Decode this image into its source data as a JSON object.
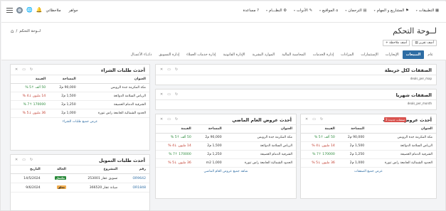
{
  "topbar": {
    "user_label": "جواهر",
    "notes_label": "ملاحظاتي",
    "nav": [
      {
        "label": "التطبيقات",
        "icon": "grid-icon"
      },
      {
        "label": "المشاريع و المهام",
        "icon": "flag-icon"
      },
      {
        "label": "الترحمان",
        "icon": "book-icon"
      },
      {
        "label": "المواقيع",
        "icon": "home-icon"
      },
      {
        "label": "الأدوات",
        "icon": "wrench-icon"
      },
      {
        "label": "النظـــام",
        "icon": "gear-icon"
      },
      {
        "label": "مساعدة",
        "icon": "help-icon"
      }
    ]
  },
  "header": {
    "page_title": "لــوحة التحكم",
    "breadcrumb": "لــوحة التحكم",
    "btn_report": "أضف تقرير",
    "btn_note": "أضف ملاحظة"
  },
  "tabs": [
    {
      "label": "عام",
      "active": false
    },
    {
      "label": "المبيعات",
      "active": true
    },
    {
      "label": "الإيجارات",
      "active": false
    },
    {
      "label": "الإستثمارات",
      "active": false
    },
    {
      "label": "المزادات",
      "active": false
    },
    {
      "label": "إدارة الخدمات",
      "active": false
    },
    {
      "label": "المحاسبة المالية",
      "active": false
    },
    {
      "label": "الموارد البشرية",
      "active": false
    },
    {
      "label": "الإدارة القانونية",
      "active": false
    },
    {
      "label": "إدارة خدمات العملاء",
      "active": false
    },
    {
      "label": "إدارة التسويق",
      "active": false
    },
    {
      "label": "ذكــاء الأعمـال",
      "active": false
    }
  ],
  "panels": {
    "deals_map": {
      "title": "الصفقات لكل خريطة",
      "sub": "deals_per_map"
    },
    "deals_month": {
      "title": "الصفقات شهريا",
      "sub": "deals_per_month"
    },
    "sales_offers": {
      "title": "أحدث عروض المبيعات",
      "badge": "3 صفقات جديدة",
      "cols": [
        "العنوان",
        "المساحة",
        "القيمة"
      ],
      "rows": [
        {
          "addr": "مكة المكرمة جدة الروبس",
          "area": "90,000 م2",
          "val": "50 ألف",
          "pct": "5 %",
          "dir": "up"
        },
        {
          "addr": "الرياض السلامة الدوائعة",
          "area": "1,500 م2",
          "val": "14 مليون",
          "pct": "4 %",
          "dir": "down"
        },
        {
          "addr": "الشرقية الدمام العصيفة",
          "area": "1,250 م2",
          "val": "170000",
          "pct": "7 %",
          "dir": "up"
        },
        {
          "addr": "الحدود الشمالية الجامعة راس تنورة",
          "area": "1,000 م2",
          "val": "36 مليون",
          "pct": "5 %",
          "dir": "down"
        }
      ],
      "footer": "عرض جميع الصفقات"
    },
    "rent_offers": {
      "title": "أحدث عروض العام الماضي",
      "cols": [
        "العنوان",
        "المساحة",
        "القيمة"
      ],
      "rows": [
        {
          "addr": "مكة المكرمة جدة الروبس",
          "area": "90,000 م2",
          "val": "50 ألف",
          "pct": "5 %",
          "dir": "up"
        },
        {
          "addr": "الرياض السلامة الدوائعة",
          "area": "1,500 م2",
          "val": "14 مليون",
          "pct": "4 %",
          "dir": "down"
        },
        {
          "addr": "الشرقية الدمام العصيفة",
          "area": "1,250 م2",
          "val": "170000",
          "pct": "7 %",
          "dir": "up"
        },
        {
          "addr": "الحدود الشمالية الجامعة راس تنورة",
          "area": "1,000 m2",
          "val": "36 مليون",
          "pct": "5 %",
          "dir": "down"
        }
      ],
      "footer": "شاهد جميع عروض العام الماضي"
    },
    "buy_requests": {
      "title": "أحدث طلبات الشراء",
      "cols": [
        "العنوان",
        "المساحة",
        "القيمة"
      ],
      "rows": [
        {
          "addr": "مكة المكرمة جدة الروبس",
          "area": "90,000 م2",
          "val": "50 ألف",
          "pct": "5 %",
          "dir": "up"
        },
        {
          "addr": "الرياض السلامة الدوائعة",
          "area": "1,500 م2",
          "val": "14 مليون",
          "pct": "4 %",
          "dir": "down"
        },
        {
          "addr": "الشرقية الدمام العصيفة",
          "area": "1,250 م2",
          "val": "170000",
          "pct": "7 %",
          "dir": "up"
        },
        {
          "addr": "الحدود الشمالية الجامعة راس تنورة",
          "area": "1,000 م2",
          "val": "36 مليون",
          "pct": "5 %",
          "dir": "down"
        }
      ],
      "footer": "عرض جميع طلبات الشراء"
    },
    "finance_requests": {
      "title": "أحدث طلبات التمويل",
      "cols": [
        "رقم",
        "المشروع",
        "الحالة",
        "التاريخ"
      ],
      "rows": [
        {
          "num": "OR9642",
          "project": "تسويق عقار 253001",
          "status": "مكتمل",
          "status_type": "ok",
          "date": "14/5/2024"
        },
        {
          "num": "OR1848",
          "project": "صيانة عقار 366520",
          "status": "معلق",
          "status_type": "warn",
          "date": "9/6/2024"
        }
      ]
    }
  },
  "colors": {
    "accent": "#2e6da4",
    "up": "#2a8a3a",
    "down": "#c0392b",
    "badge": "#d9534f"
  }
}
